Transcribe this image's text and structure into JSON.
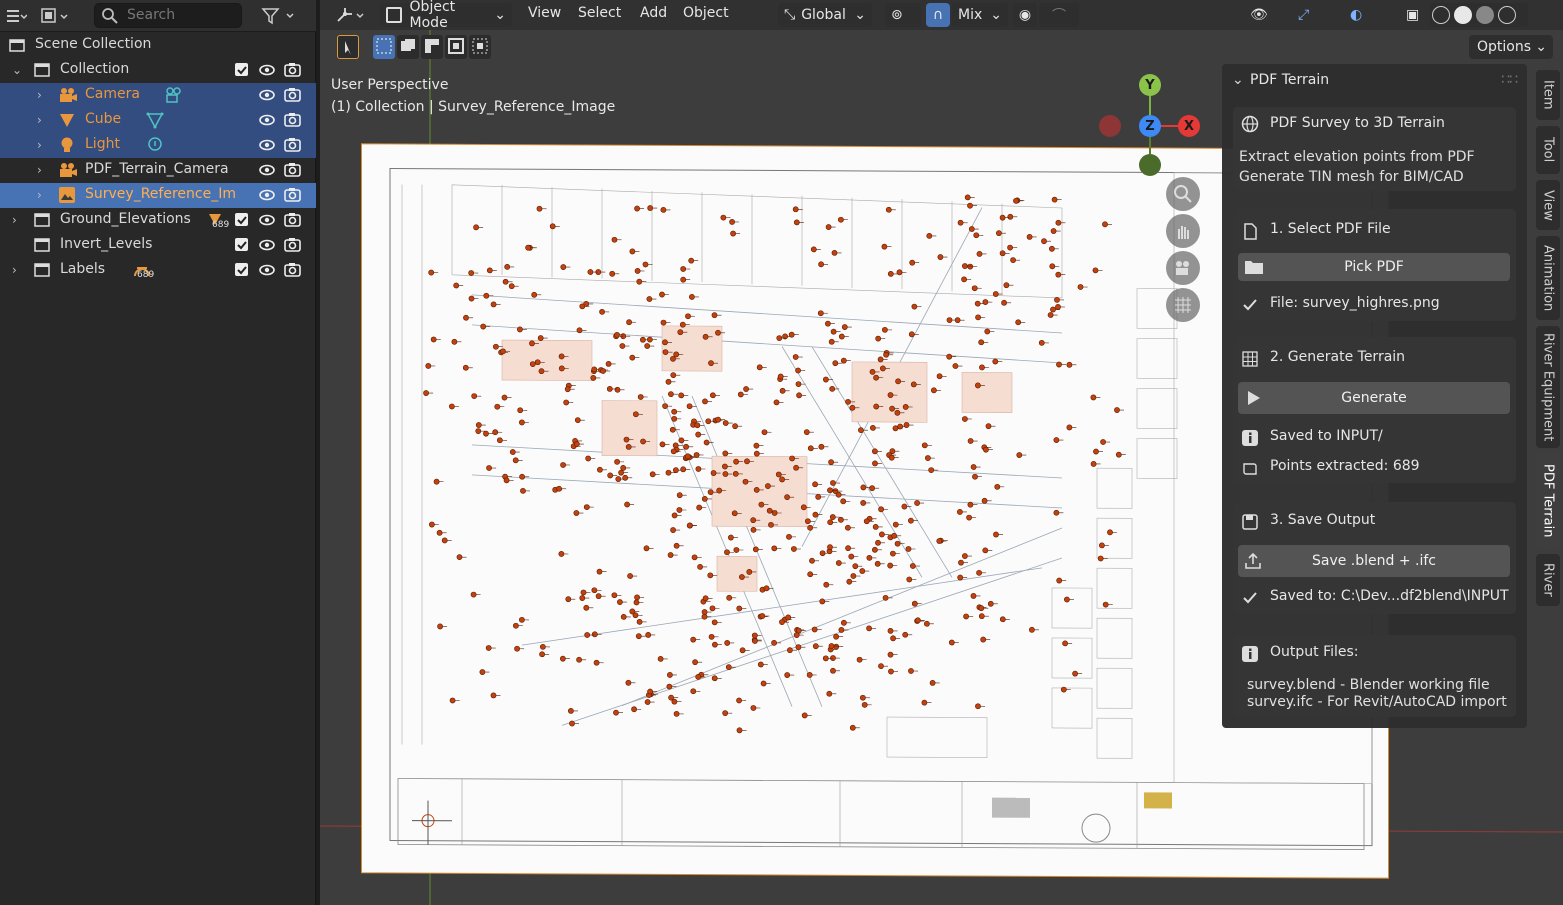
{
  "outliner": {
    "search_placeholder": "Search",
    "root_label": "Scene Collection",
    "rows": [
      {
        "label": "Collection",
        "type": "collection"
      },
      {
        "label": "Camera",
        "type": "object"
      },
      {
        "label": "Cube",
        "type": "object"
      },
      {
        "label": "Light",
        "type": "object"
      },
      {
        "label": "PDF_Terrain_Camera",
        "type": "object"
      },
      {
        "label": "Survey_Reference_Im",
        "type": "object"
      },
      {
        "label": "Ground_Elevations",
        "type": "collection",
        "badge": "689"
      },
      {
        "label": "Invert_Levels",
        "type": "collection"
      },
      {
        "label": "Labels",
        "type": "collection",
        "badge": "689"
      }
    ]
  },
  "viewport": {
    "mode": "Object Mode",
    "menus": [
      "View",
      "Select",
      "Add",
      "Object"
    ],
    "orientation": "Global",
    "snap_mix": "Mix",
    "options_label": "Options",
    "perspective_label": "User Perspective",
    "collection_info": "(1) Collection | Survey_Reference_Image",
    "gizmo": {
      "y": "Y",
      "z": "Z",
      "x": "X"
    }
  },
  "panel": {
    "title": "PDF Terrain",
    "header_title": "PDF Survey to 3D Terrain",
    "header_desc_1": "Extract elevation points from PDF",
    "header_desc_2": "Generate TIN mesh for BIM/CAD",
    "step1_title": "1. Select PDF File",
    "pick_button": "Pick PDF",
    "file_status": "File: survey_highres.png",
    "step2_title": "2. Generate Terrain",
    "generate_button": "Generate",
    "saved_input": "Saved to INPUT/",
    "points_extracted": "Points extracted: 689",
    "step3_title": "3. Save Output",
    "save_button": "Save .blend + .ifc",
    "saved_path": "Saved to: C:\\Dev...df2blend\\INPUT",
    "output_title": "Output Files:",
    "output_line_1": "survey.blend  -  Blender working file",
    "output_line_2": "survey.ifc  -  For Revit/AutoCAD import"
  },
  "tabs": [
    "Item",
    "Tool",
    "View",
    "Animation",
    "River Equipment",
    "PDF Terrain",
    "River"
  ],
  "colors": {
    "accent": "#4772b3",
    "object_orange": "#e8973d",
    "point_marker": "#c2410c"
  }
}
